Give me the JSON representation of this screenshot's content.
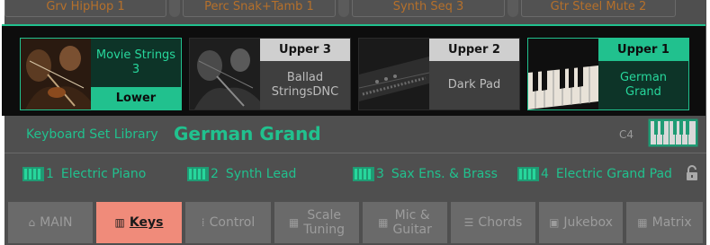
{
  "top_pads": [
    "Grv HipHop 1",
    "Perc Snak+Tamb 1",
    "Synth Seq 3",
    "Gtr Steel Mute 2"
  ],
  "keyboard_set_popup": {
    "slots": [
      {
        "role": "Lower",
        "sound": "Movie Strings 3",
        "state": "active",
        "image": "violin-players"
      },
      {
        "role": "Upper 3",
        "sound": "Ballad StringsDNC",
        "state": "inactive",
        "image": "violin-players-dim"
      },
      {
        "role": "Upper 2",
        "sound": "Dark Pad",
        "state": "inactive",
        "image": "synthesizer-keyboard"
      },
      {
        "role": "Upper 1",
        "sound": "German Grand",
        "state": "active",
        "image": "piano-keys"
      }
    ]
  },
  "library": {
    "label": "Keyboard Set Library",
    "value": "German Grand",
    "split_point": "C4"
  },
  "keyboards": [
    {
      "num": "1",
      "name": "Electric Piano"
    },
    {
      "num": "2",
      "name": "Synth Lead"
    },
    {
      "num": "3",
      "name": "Sax Ens. & Brass"
    },
    {
      "num": "4",
      "name": "Electric Grand Pad"
    }
  ],
  "tabs": [
    {
      "label": "MAIN",
      "icon": "home-icon",
      "active": false
    },
    {
      "label": "Keys",
      "icon": "keyboard-icon",
      "active": true
    },
    {
      "label": "Control",
      "icon": "slider-icon",
      "active": false
    },
    {
      "line1": "Scale",
      "line2": "Tuning",
      "icon": "scale-icon",
      "active": false
    },
    {
      "line1": "Mic &",
      "line2": "Guitar",
      "icon": "mic-icon",
      "active": false
    },
    {
      "label": "Chords",
      "icon": "chords-icon",
      "active": false
    },
    {
      "label": "Jukebox",
      "icon": "jukebox-icon",
      "active": false
    },
    {
      "label": "Matrix",
      "icon": "matrix-icon",
      "active": false
    }
  ],
  "colors": {
    "accent": "#21c18e",
    "active_tab": "#f08b7a",
    "popup_bg": "#0d0d0d",
    "screen_bg": "#4f4f4f"
  }
}
